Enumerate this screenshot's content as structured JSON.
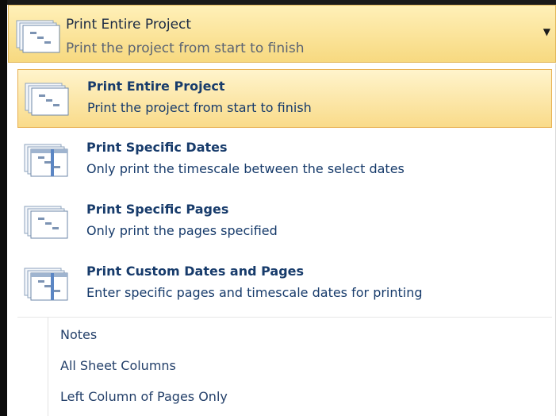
{
  "header": {
    "title": "Print Entire Project",
    "subtitle": "Print the project from start to finish",
    "icon": "stacked-pages-icon",
    "arrow_icon": "dropdown-arrow-icon"
  },
  "items": [
    {
      "title": "Print Entire Project",
      "desc": "Print the project from start to finish",
      "icon": "stacked-pages-icon",
      "selected": true
    },
    {
      "title": "Print Specific Dates",
      "desc": "Only print the timescale between the select dates",
      "icon": "timescale-pages-icon",
      "selected": false
    },
    {
      "title": "Print Specific Pages",
      "desc": "Only print the pages specified",
      "icon": "stacked-pages-icon",
      "selected": false
    },
    {
      "title": "Print Custom Dates and Pages",
      "desc": "Enter specific pages and timescale dates for printing",
      "icon": "timescale-pages-icon",
      "selected": false
    }
  ],
  "options": [
    "Notes",
    "All Sheet Columns",
    "Left Column of Pages Only"
  ],
  "colors": {
    "highlight_top": "#fff4cc",
    "highlight_bottom": "#f9db8a",
    "highlight_border": "#e8b052",
    "text_blue": "#173b6b"
  }
}
